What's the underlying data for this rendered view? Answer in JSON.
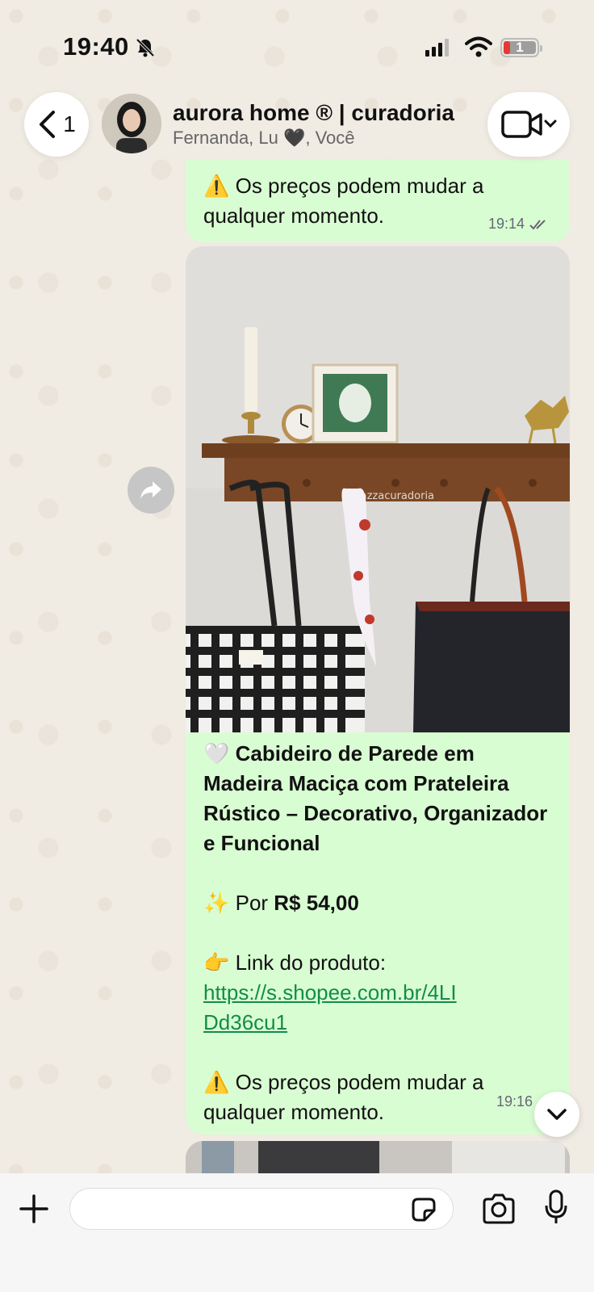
{
  "status_bar": {
    "time": "19:40",
    "battery": "1"
  },
  "header": {
    "back_count": "1",
    "title": "aurora home ® | curadoria",
    "subtitle": "Fernanda, Lu 🖤, Você"
  },
  "messages": [
    {
      "text": "⚠️ Os preços podem mudar a qualquer momento.",
      "time": "19:14"
    },
    {
      "image_watermark": "@lazzacuradoria",
      "title": "🤍 Cabideiro de Parede em Madeira Maciça com Prateleira Rústico – Decorativo, Organizador e Funcional",
      "price_prefix": "✨ Por ",
      "price": "R$ 54,00",
      "link_label": "👉 Link do produto:",
      "link": "https://s.shopee.com.br/4LIDd36cu1",
      "warning": "⚠️ Os preços podem mudar a qualquer momento.",
      "time": "19:16"
    }
  ],
  "composer": {
    "placeholder": ""
  },
  "colors": {
    "bubble": "#d9fdd3",
    "link": "#128c4b",
    "background": "#efeae2"
  }
}
